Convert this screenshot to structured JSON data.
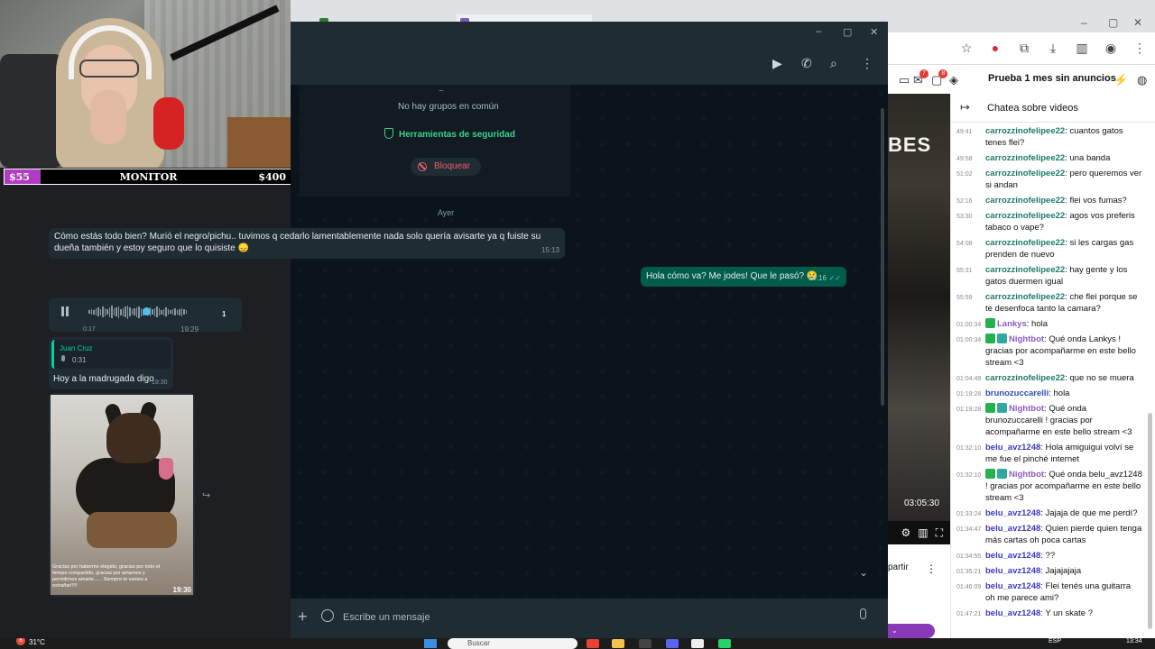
{
  "overlay": {
    "goal_current": "$55",
    "goal_label": "MONITOR",
    "goal_target": "$400"
  },
  "browser": {
    "promo": "Prueba 1 mes sin anuncios",
    "badges": [
      "7",
      "8"
    ],
    "video_overlay_title": "BES",
    "video_time": "03:05:30",
    "share_label": "partir"
  },
  "chat": {
    "header": "Chatea sobre videos",
    "messages": [
      {
        "t": "49:41",
        "user": "carrozzinofelipee22",
        "color": "teal",
        "text": "cuantos gatos tenes flei?",
        "badges": []
      },
      {
        "t": "49:58",
        "user": "carrozzinofelipee22",
        "color": "teal",
        "text": "una banda",
        "badges": []
      },
      {
        "t": "51:02",
        "user": "carrozzinofelipee22",
        "color": "teal",
        "text": "pero queremos ver si andan",
        "badges": []
      },
      {
        "t": "52:16",
        "user": "carrozzinofelipee22",
        "color": "teal",
        "text": "flei vos fumas?",
        "badges": []
      },
      {
        "t": "53:30",
        "user": "carrozzinofelipee22",
        "color": "teal",
        "text": "agos vos preferis tabaco o vape?",
        "badges": []
      },
      {
        "t": "54:08",
        "user": "carrozzinofelipee22",
        "color": "teal",
        "text": "si les cargas gas prenden de nuevo",
        "badges": []
      },
      {
        "t": "55:31",
        "user": "carrozzinofelipee22",
        "color": "teal",
        "text": "hay gente y los gatos duermen igual",
        "badges": []
      },
      {
        "t": "55:59",
        "user": "carrozzinofelipee22",
        "color": "teal",
        "text": "che flei porque se te desenfoca tanto la camara?",
        "badges": []
      },
      {
        "t": "01:00:34",
        "user": "Lankys",
        "color": "purple",
        "text": "hola",
        "badges": [
          "green"
        ]
      },
      {
        "t": "01:00:34",
        "user": "Nightbot",
        "color": "purple",
        "text": "Qué onda Lankys ! gracias por acompañarme en este bello stream <3",
        "badges": [
          "green",
          "teal"
        ]
      },
      {
        "t": "01:04:49",
        "user": "carrozzinofelipee22",
        "color": "teal",
        "text": "que no se muera",
        "badges": []
      },
      {
        "t": "01:19:28",
        "user": "brunozuccarelli",
        "color": "blue",
        "text": "hola",
        "badges": []
      },
      {
        "t": "01:19:28",
        "user": "Nightbot",
        "color": "purple",
        "text": "Qué onda brunozuccarelli ! gracias por acompañarme en este bello stream <3",
        "badges": [
          "green",
          "teal"
        ]
      },
      {
        "t": "01:32:10",
        "user": "belu_avz1248",
        "color": "navy",
        "text": "Hola amiguigui volví se me fue el pinché internet",
        "badges": []
      },
      {
        "t": "01:32:10",
        "user": "Nightbot",
        "color": "purple",
        "text": "Qué onda belu_avz1248 ! gracias por acompañarme en este bello stream <3",
        "badges": [
          "green",
          "teal"
        ]
      },
      {
        "t": "01:33:24",
        "user": "belu_avz1248",
        "color": "navy",
        "text": "Jajaja de que me perdí?",
        "badges": []
      },
      {
        "t": "01:34:47",
        "user": "belu_avz1248",
        "color": "navy",
        "text": "Quien pierde quien tenga más cartas oh poca cartas",
        "badges": []
      },
      {
        "t": "01:34:55",
        "user": "belu_avz1248",
        "color": "navy",
        "text": "??",
        "badges": []
      },
      {
        "t": "01:35:21",
        "user": "belu_avz1248",
        "color": "navy",
        "text": "Jajajajaja",
        "badges": []
      },
      {
        "t": "01:46:09",
        "user": "belu_avz1248",
        "color": "navy",
        "text": "Flei tenés una guitarra oh me parece ami?",
        "badges": []
      },
      {
        "t": "01:47:21",
        "user": "belu_avz1248",
        "color": "navy",
        "text": "Y un skate ?",
        "badges": []
      }
    ]
  },
  "whatsapp": {
    "info": {
      "tilde": "~",
      "no_groups": "No hay grupos en común",
      "safety_tools": "Herramientas de seguridad",
      "block": "Bloquear"
    },
    "day_label": "Ayer",
    "msg_in_1": {
      "text": "Cómo estás todo bien? Murió el negro/pichu.. tuvimos q cedarlo lamentablemente nada solo quería avisarte ya q fuiste su dueña también y estoy seguro que lo quisiste 😞",
      "time": "15:13"
    },
    "msg_out_1": {
      "text": "Hola cómo va? Me jodes! Que le pasó? 😢",
      "time": "19:16"
    },
    "voice": {
      "elapsed": "0:17",
      "time": "19:29",
      "speed": "1",
      "progress": 0.55
    },
    "reply": {
      "quoted_name": "Juan Cruz",
      "quoted_duration": "0:31",
      "text": "Hoy a la madrugada digo",
      "time": "19:30"
    },
    "photo": {
      "caption": "Gracias por haberme elegido, gracias por todo el tiempo compartido, gracias por amarnos y permitirnos amarte...... Siempre te vamos a extrañar!!!!!",
      "time": "19:30"
    },
    "input_placeholder": "Escribe un mensaje"
  },
  "taskbar": {
    "weather": "31°C",
    "weather_badge": "6",
    "search_placeholder": "Buscar",
    "lang": "ESP",
    "clock": "13:34"
  }
}
